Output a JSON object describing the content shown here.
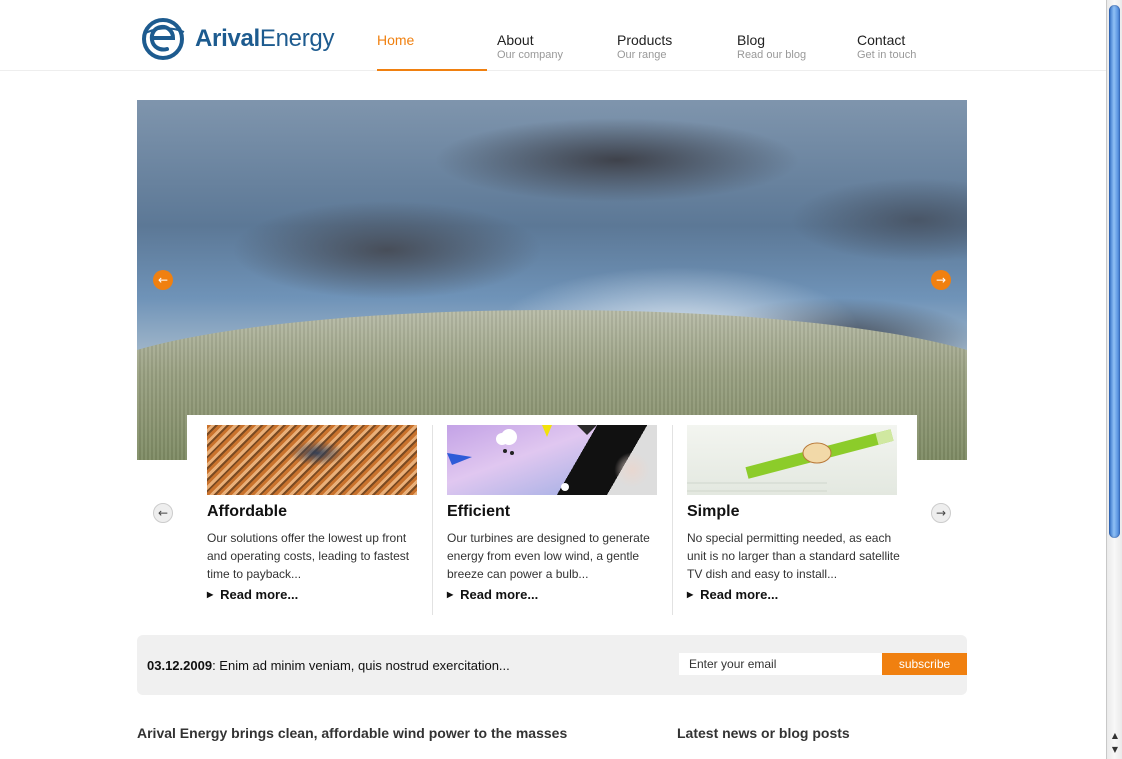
{
  "brand": {
    "name_bold": "Arival",
    "name_light": "Energy",
    "color": "#1d5b8f"
  },
  "accent_color": "#f08010",
  "nav": [
    {
      "label": "Home",
      "sub": "",
      "active": true
    },
    {
      "label": "About",
      "sub": "Our company",
      "active": false
    },
    {
      "label": "Products",
      "sub": "Our range",
      "active": false
    },
    {
      "label": "Blog",
      "sub": "Read our blog",
      "active": false
    },
    {
      "label": "Contact",
      "sub": "Get in touch",
      "active": false
    }
  ],
  "hero": {
    "prev_icon": "arrow-left-icon",
    "next_icon": "arrow-right-icon"
  },
  "features": [
    {
      "title": "Affordable",
      "text": "Our solutions offer the lowest up front and operating costs, leading to fastest time to payback...",
      "more": "Read more..."
    },
    {
      "title": "Efficient",
      "text": "Our turbines are designed to generate energy from even low wind, a gentle breeze can power a bulb...",
      "more": "Read more..."
    },
    {
      "title": "Simple",
      "text": "No special permitting needed, as each unit is no larger than a standard satellite TV dish and easy to install...",
      "more": "Read more..."
    }
  ],
  "news": {
    "date": "03.12.2009",
    "text": ": Enim ad minim veniam, quis nostrud exercitation..."
  },
  "subscribe": {
    "placeholder": "Enter your email",
    "button": "subscribe"
  },
  "headings": {
    "left": "Arival Energy brings clean, affordable wind power to the masses",
    "right": "Latest news or blog posts"
  }
}
